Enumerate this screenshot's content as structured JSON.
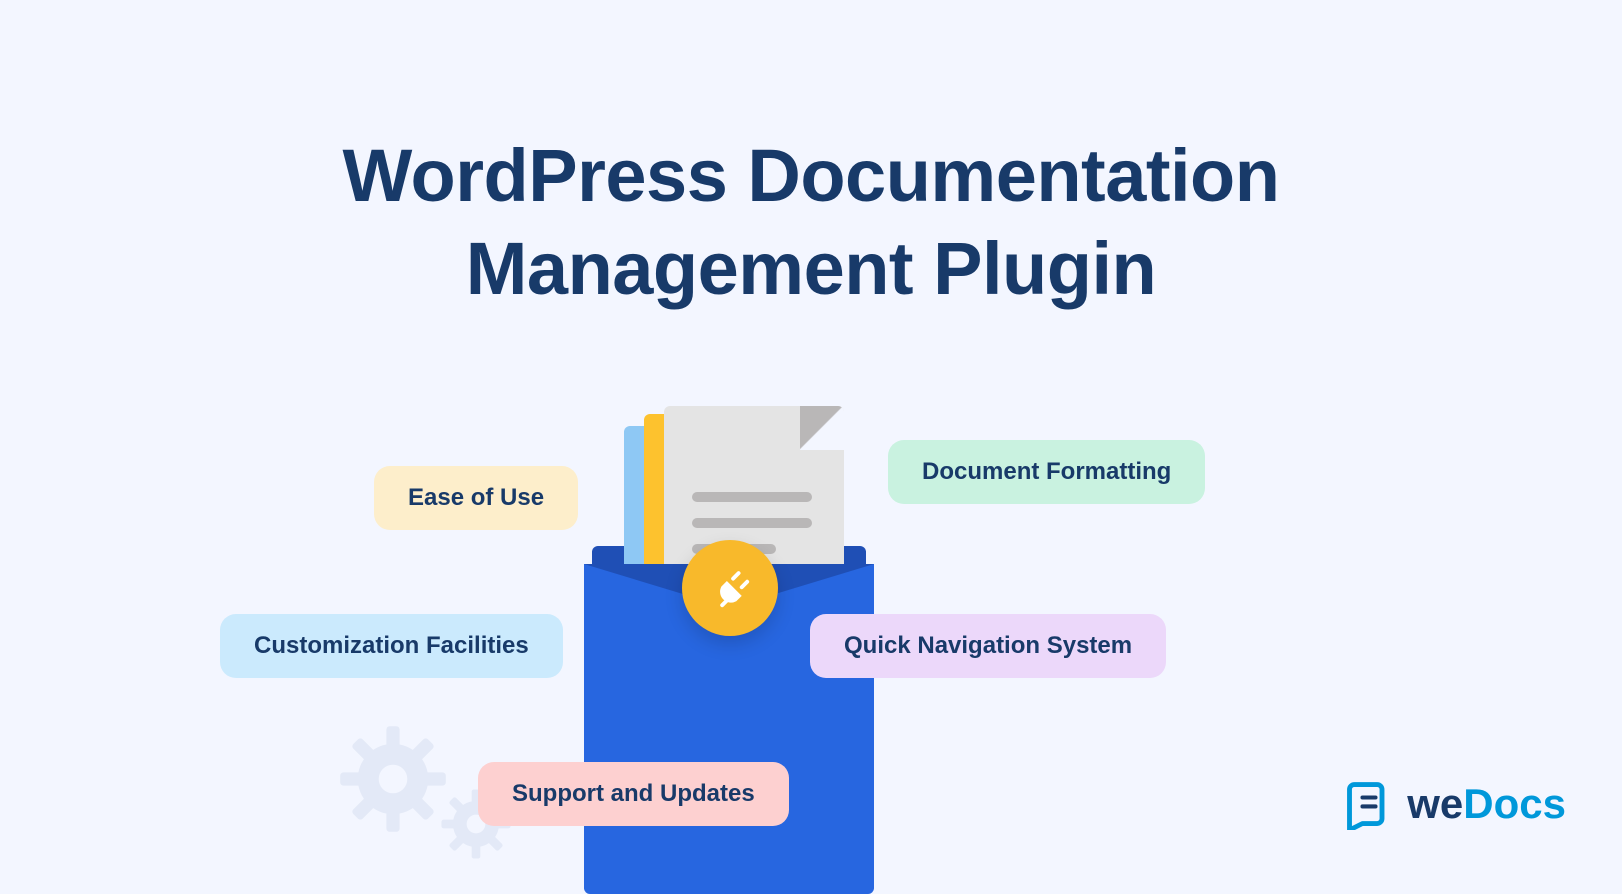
{
  "title_line1": "WordPress Documentation",
  "title_line2": "Management Plugin",
  "pills": {
    "ease": "Ease of Use",
    "custom": "Customization Facilities",
    "support": "Support and Updates",
    "docformat": "Document Formatting",
    "quicknav": "Quick Navigation System"
  },
  "brand": {
    "we": "we",
    "docs": "Docs"
  }
}
